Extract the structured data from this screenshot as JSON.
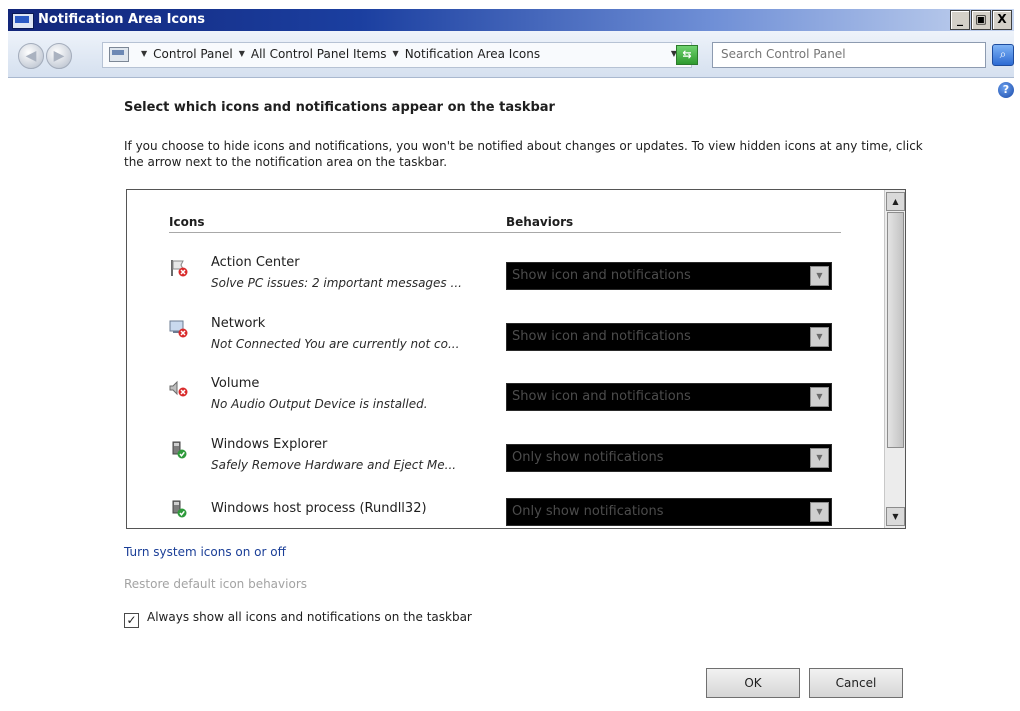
{
  "window": {
    "title": "Notification Area Icons",
    "controls": {
      "minimize": "_",
      "maximize": "ő",
      "close": "X"
    }
  },
  "address": {
    "crumbs": [
      "Control Panel",
      "All Control Panel Items",
      "Notification Area Icons"
    ],
    "search_placeholder": "Search Control Panel"
  },
  "content": {
    "heading": "Select which icons and notifications appear on the taskbar",
    "intro": "If you choose to hide icons and notifications, you won't be notified about changes or updates. To view hidden icons at any time, click the arrow next to the notification area on the taskbar.",
    "columns": {
      "icons": "Icons",
      "behaviors": "Behaviors"
    },
    "rows": [
      {
        "name": "Action Center",
        "desc": "Solve PC issues: 2 important messages ...",
        "behavior": "Show icon and notifications",
        "icon": "action-center-flag-icon"
      },
      {
        "name": "Network",
        "desc": "Not Connected You are currently not co...",
        "behavior": "Show icon and notifications",
        "icon": "network-icon"
      },
      {
        "name": "Volume",
        "desc": "No Audio Output Device is installed.",
        "behavior": "Show icon and notifications",
        "icon": "volume-icon"
      },
      {
        "name": "Windows Explorer",
        "desc": "Safely Remove Hardware and Eject Me...",
        "behavior": "Only show notifications",
        "icon": "usb-eject-icon"
      },
      {
        "name": "Windows host process (Rundll32)",
        "desc": "",
        "behavior": "Only show notifications",
        "icon": "usb-eject-icon"
      }
    ],
    "system_icons_link": "Turn system icons on or off",
    "restore_link": "Restore default icon behaviors",
    "always_show_label": "Always show all icons and notifications on the taskbar",
    "always_show_checked": true
  },
  "buttons": {
    "ok": "OK",
    "cancel": "Cancel"
  },
  "colors": {
    "titlebar": "#1b3fa0",
    "link": "#1a3e97",
    "disabled_link": "#a3a3a3"
  }
}
